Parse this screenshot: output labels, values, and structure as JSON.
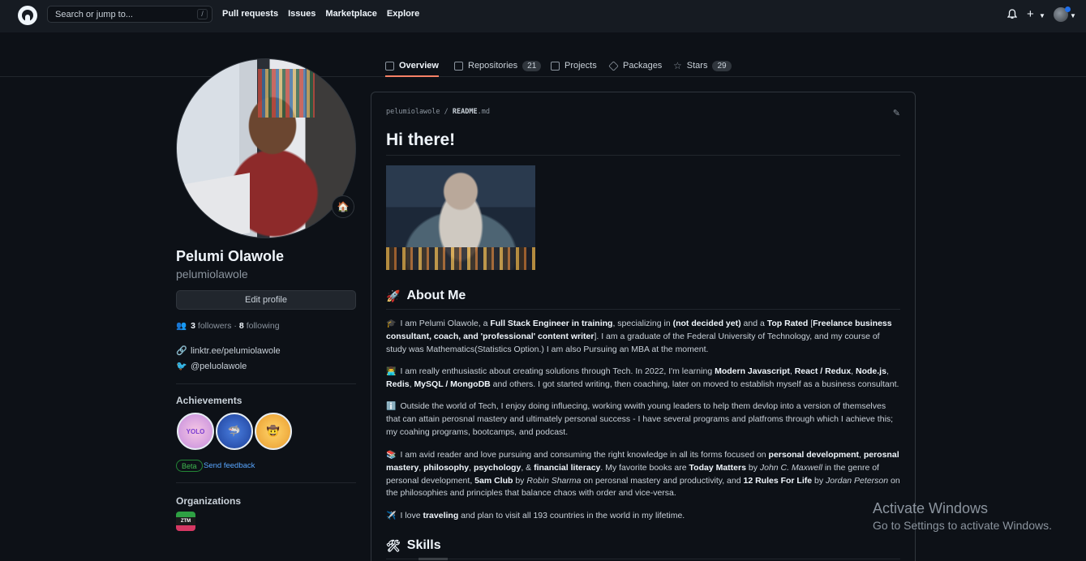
{
  "header": {
    "search_placeholder": "Search or jump to...",
    "search_shortcut": "/",
    "nav": [
      "Pull requests",
      "Issues",
      "Marketplace",
      "Explore"
    ]
  },
  "tabs": [
    {
      "label": "Overview",
      "icon": "book-icon",
      "active": true
    },
    {
      "label": "Repositories",
      "icon": "repo-icon",
      "count": "21"
    },
    {
      "label": "Projects",
      "icon": "table-icon"
    },
    {
      "label": "Packages",
      "icon": "package-icon"
    },
    {
      "label": "Stars",
      "icon": "star-icon",
      "count": "29"
    }
  ],
  "profile": {
    "name": "Pelumi Olawole",
    "username": "pelumiolawole",
    "edit_label": "Edit profile",
    "followers_count": "3",
    "followers_label": "followers",
    "following_count": "8",
    "following_label": "following",
    "separator": "·",
    "website": "linktr.ee/pelumiolawole",
    "twitter": "@peluolawole",
    "achievements_title": "Achievements",
    "achievements": [
      "YOLO",
      "Pull Shark",
      "Quickdraw"
    ],
    "beta_label": "Beta",
    "feedback_label": "Send feedback",
    "organizations_title": "Organizations",
    "org_abbr": "ZTM"
  },
  "readme": {
    "crumb_user": "pelumiolawole",
    "crumb_sep": "/",
    "crumb_file": "README",
    "crumb_ext": ".md",
    "heading": "Hi there!",
    "about_title": "About Me",
    "skills_title": "Skills"
  },
  "watermark": {
    "line1": "Activate Windows",
    "line2": "Go to Settings to activate Windows."
  },
  "colors": {
    "bg": "#0d1117",
    "header_bg": "#161b22",
    "accent_tab": "#f78166",
    "link": "#58a6ff"
  }
}
